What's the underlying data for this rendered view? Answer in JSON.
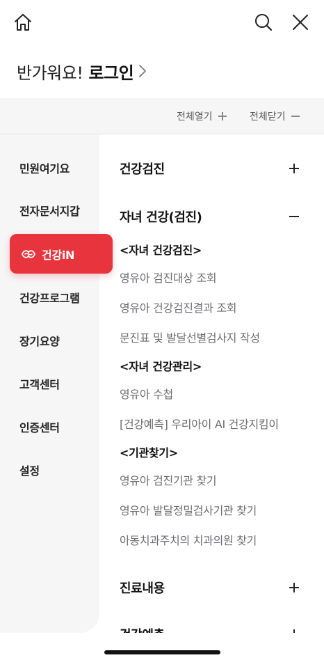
{
  "header": {
    "home_icon": "home-icon",
    "search_icon": "search-icon",
    "close_icon": "close-icon"
  },
  "greeting": {
    "text": "반가워요!",
    "login": "로그인",
    "arrow_icon": "chevron-right-icon"
  },
  "toolbar": {
    "expand_all": "전체열기",
    "collapse_all": "전체닫기"
  },
  "sidebar": {
    "items": [
      {
        "label": "민원여기요"
      },
      {
        "label": "전자문서지갑"
      },
      {
        "label": "건강iN",
        "active": true,
        "icon": "health-logo-icon"
      },
      {
        "label": "건강프로그램"
      },
      {
        "label": "장기요양"
      },
      {
        "label": "고객센터"
      },
      {
        "label": "인증센터"
      },
      {
        "label": "설정"
      }
    ],
    "active_color": "#e8343c"
  },
  "content": {
    "sections": [
      {
        "title": "건강검진",
        "state": "collapsed"
      },
      {
        "title": "자녀 건강(검진)",
        "state": "expanded",
        "groups": [
          {
            "heading": "<자녀 건강검진>",
            "links": [
              "영유아 검진대상 조회",
              "영유아 건강검진결과 조회",
              "문진표 및 발달선별검사지 작성"
            ]
          },
          {
            "heading": "<자녀 건강관리>",
            "links": [
              "영유아 수첩",
              "[건강예측] 우리아이 AI 건강지킴이"
            ]
          },
          {
            "heading": "<기관찾기>",
            "links": [
              "영유아 검진기관 찾기",
              "영유아 발달정밀검사기관 찾기",
              "아동치과주치의 치과의원 찾기"
            ]
          }
        ]
      },
      {
        "title": "진료내용",
        "state": "collapsed"
      },
      {
        "title": "건강예측",
        "state": "collapsed"
      }
    ]
  }
}
